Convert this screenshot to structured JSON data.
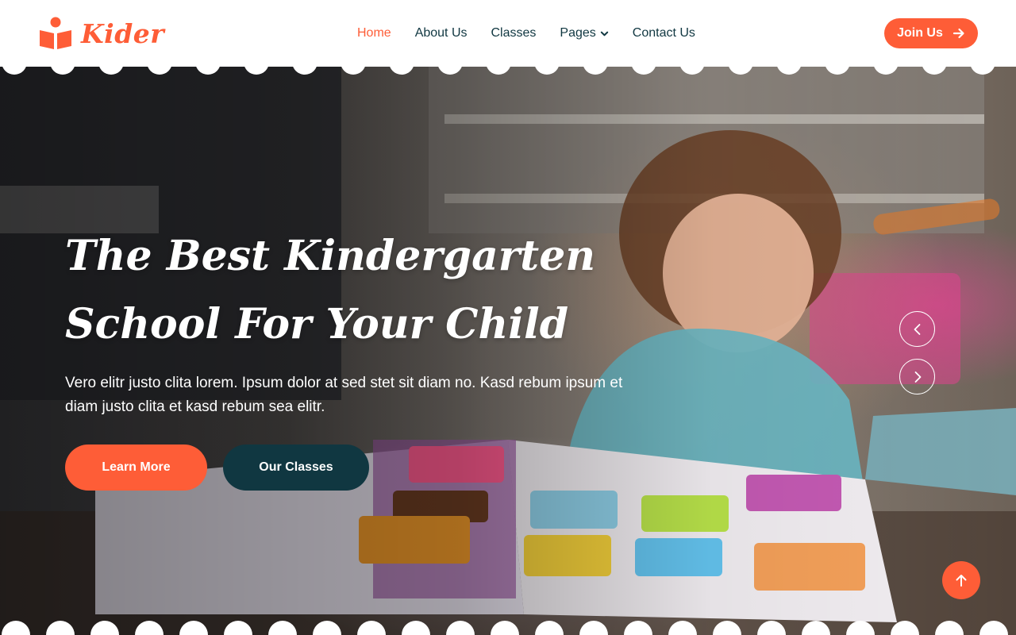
{
  "brand": {
    "name": "Kider",
    "icon": "book-reader-icon"
  },
  "nav": {
    "items": [
      {
        "label": "Home",
        "active": true
      },
      {
        "label": "About Us",
        "active": false
      },
      {
        "label": "Classes",
        "active": false
      },
      {
        "label": "Pages",
        "active": false,
        "dropdown": true
      },
      {
        "label": "Contact Us",
        "active": false
      }
    ],
    "cta": {
      "label": "Join Us",
      "icon": "arrow-right-icon"
    }
  },
  "hero": {
    "title_line1": "The Best Kindergarten",
    "title_line2": "School For Your Child",
    "text": "Vero elitr justo clita lorem. Ipsum dolor at sed stet sit diam no. Kasd rebum ipsum et diam justo clita et kasd rebum sea elitr.",
    "primary_button": "Learn More",
    "secondary_button": "Our Classes",
    "image": "photo-of-toddler-reading-picture-book"
  },
  "carousel": {
    "prev_icon": "chevron-left-icon",
    "next_icon": "chevron-right-icon"
  },
  "back_to_top": {
    "icon": "arrow-up-icon"
  },
  "colors": {
    "primary": "#FE5D37",
    "dark": "#103741",
    "white": "#FFFFFF"
  }
}
